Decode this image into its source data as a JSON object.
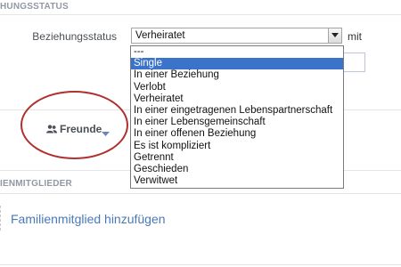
{
  "header": {
    "title": "HUNGSSTATUS"
  },
  "relationship": {
    "label": "Beziehungsstatus",
    "selected": "Verheiratet",
    "with_label": "mit",
    "options": [
      "---",
      "Single",
      "In einer Beziehung",
      "Verlobt",
      "Verheiratet",
      "In einer eingetragenen Lebenspartnerschaft",
      "In einer Lebensgemeinschaft",
      "In einer offenen Beziehung",
      "Es ist kompliziert",
      "Getrennt",
      "Geschieden",
      "Verwitwet"
    ],
    "highlighted_index": 1
  },
  "privacy": {
    "label": "Freunde"
  },
  "family": {
    "title": "IENMITGLIEDER",
    "add_label": "Familienmitglied hinzufügen"
  },
  "colors": {
    "highlight": "#3a73c9",
    "annotation_circle": "#b0302e",
    "link": "#4a78b8"
  }
}
